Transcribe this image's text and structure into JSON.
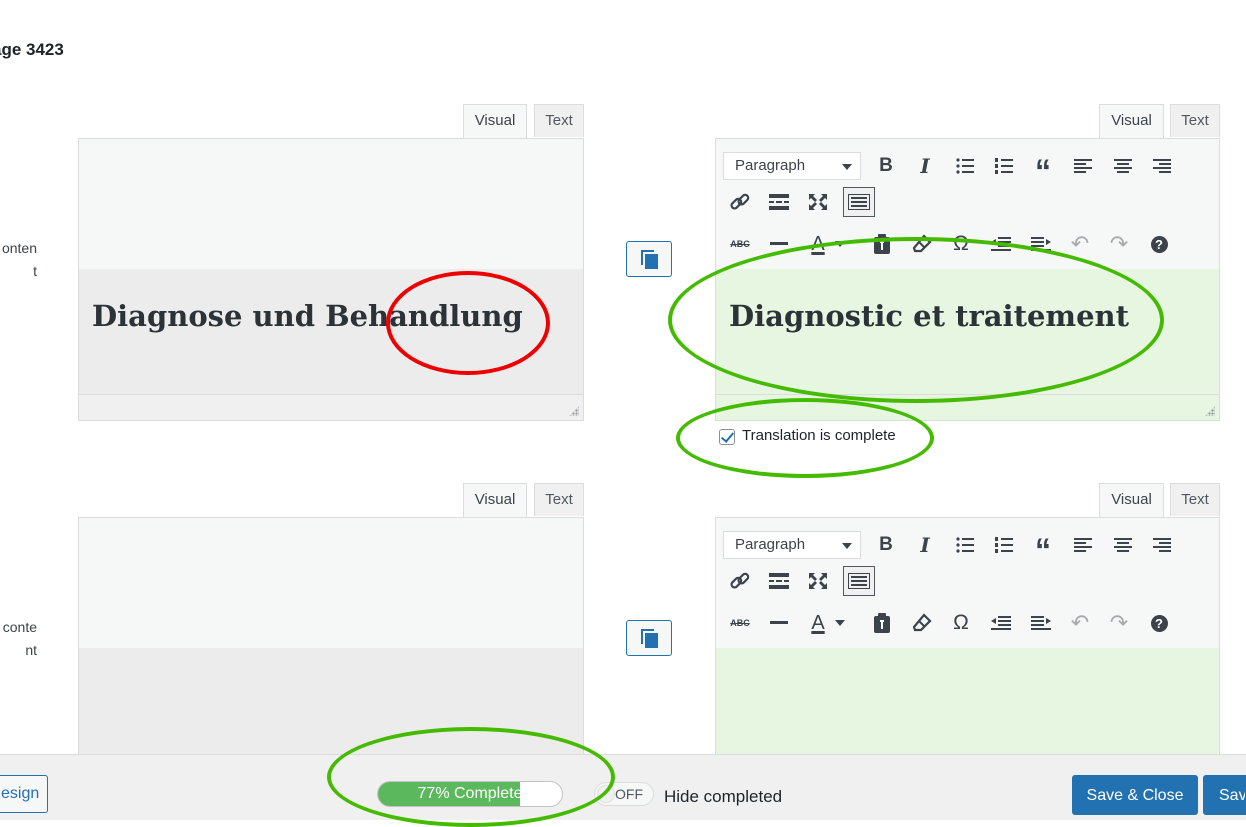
{
  "page": {
    "title": "age 3423"
  },
  "fields": [
    {
      "label_line1": "onten",
      "label_line2": "t",
      "source": {
        "tab_visual": "Visual",
        "tab_text": "Text",
        "heading": "Diagnose und Behandlung"
      },
      "target": {
        "tab_visual": "Visual",
        "tab_text": "Text",
        "format_select": "Paragraph",
        "heading": "Diagnostic et traitement",
        "complete_label": "Translation is complete",
        "complete_checked": true
      }
    },
    {
      "label_line1": "conte",
      "label_line2": "nt",
      "source": {
        "tab_visual": "Visual",
        "tab_text": "Text",
        "heading": ""
      },
      "target": {
        "tab_visual": "Visual",
        "tab_text": "Text",
        "format_select": "Paragraph",
        "heading": ""
      }
    }
  ],
  "toolbar_icons": {
    "row1": [
      "bold-icon",
      "italic-icon",
      "bullet-list-icon",
      "numbered-list-icon",
      "blockquote-icon",
      "align-left-icon",
      "align-center-icon",
      "align-right-icon"
    ],
    "row2": [
      "link-icon",
      "read-more-icon",
      "fullscreen-icon",
      "toolbar-toggle-icon"
    ],
    "row3": [
      "strikethrough-icon",
      "horizontal-line-icon",
      "text-color-icon",
      "paste-text-icon",
      "clear-formatting-icon",
      "special-character-icon",
      "outdent-icon",
      "indent-icon",
      "undo-icon",
      "redo-icon",
      "help-icon"
    ],
    "glyphs": {
      "bold": "B",
      "italic": "I",
      "blockquote": "“",
      "abc": "ABC",
      "text_color": "A",
      "omega": "Ω",
      "undo": "↶",
      "redo": "↷",
      "help": "?"
    }
  },
  "footer": {
    "resign_label": "esign",
    "progress_label": "77% Complete",
    "progress_value": 0.77,
    "toggle_label": "OFF",
    "hide_completed_label": "Hide completed",
    "save_close_label": "Save & Close",
    "save_label": "Save"
  },
  "colors": {
    "accent": "#2271b1",
    "progress_green": "#5cb85c",
    "target_bg": "#e6f6e1",
    "annotation_green": "#44bb00",
    "annotation_red": "#ee0000"
  }
}
